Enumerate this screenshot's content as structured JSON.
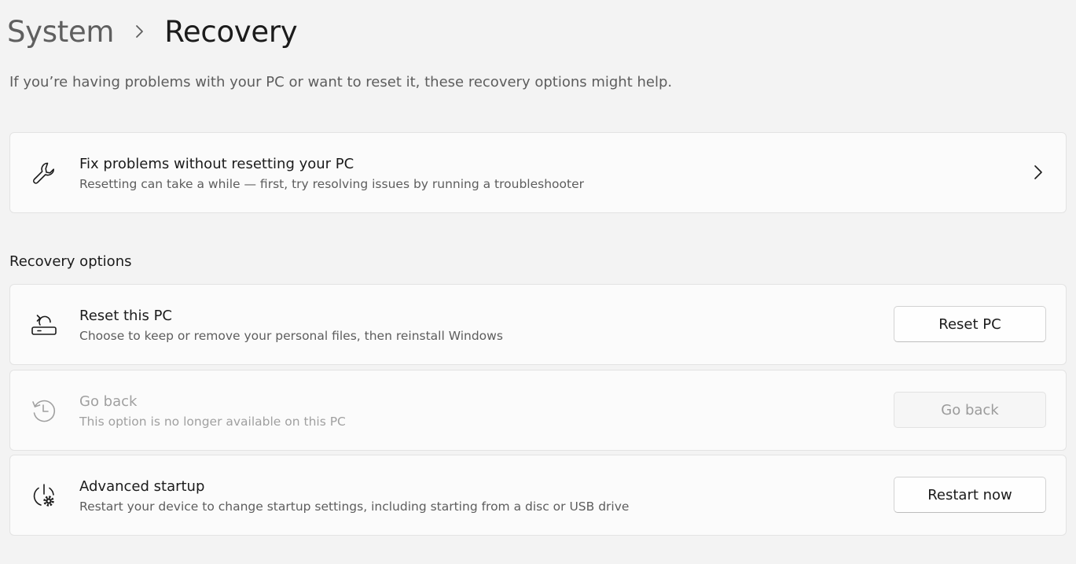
{
  "breadcrumb": {
    "parent": "System",
    "separator_icon": "chevron-right-icon",
    "current": "Recovery"
  },
  "subtitle": "If you’re having problems with your PC or want to reset it, these recovery options might help.",
  "fix_problems": {
    "icon": "wrench-icon",
    "title": "Fix problems without resetting your PC",
    "description": "Resetting can take a while — first, try resolving issues by running a troubleshooter",
    "action_icon": "chevron-right-icon"
  },
  "recovery_options": {
    "section_title": "Recovery options",
    "items": [
      {
        "icon": "reset-pc-icon",
        "title": "Reset this PC",
        "description": "Choose to keep or remove your personal files, then reinstall Windows",
        "button_label": "Reset PC",
        "enabled": true
      },
      {
        "icon": "history-icon",
        "title": "Go back",
        "description": "This option is no longer available on this PC",
        "button_label": "Go back",
        "enabled": false
      },
      {
        "icon": "power-gear-icon",
        "title": "Advanced startup",
        "description": "Restart your device to change startup settings, including starting from a disc or USB drive",
        "button_label": "Restart now",
        "enabled": true
      }
    ]
  },
  "colors": {
    "background": "#f3f3f3",
    "card": "#fbfbfb",
    "text_primary": "#1b1b1b",
    "text_secondary": "#5d5d5d",
    "text_disabled": "#a0a0a0"
  }
}
